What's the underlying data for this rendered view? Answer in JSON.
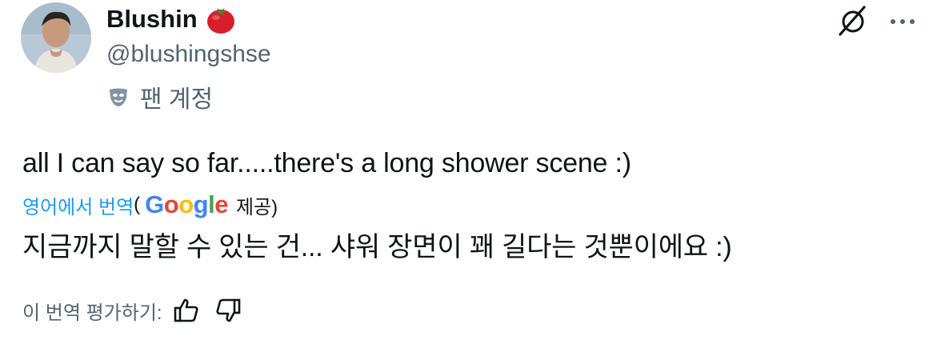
{
  "author": {
    "display_name": "Blushin",
    "handle": "@blushingshse",
    "badge_label": "팬 계정"
  },
  "icons": {
    "avatar": "profile-photo",
    "name_emoji": "tomato-icon",
    "badge": "theater-mask-icon",
    "grok": "grok-icon",
    "more": "more-icon",
    "thumbs_up": "thumbs-up-icon",
    "thumbs_down": "thumbs-down-icon"
  },
  "tweet": {
    "text": "all I can say so far.....there's a long shower scene :)",
    "translate_link": "영어에서 번역",
    "paren_open": "(",
    "google": [
      "G",
      "o",
      "o",
      "g",
      "l",
      "e"
    ],
    "provided": "제공)",
    "translated_text": "지금까지 말할 수 있는 건... 샤워 장면이 꽤 길다는 것뿐이에요 :)",
    "rate_label": "이 번역 평가하기:"
  },
  "colors": {
    "text": "#0f1419",
    "secondary": "#536471",
    "link": "#1d9bf0",
    "google_blue": "#4285F4",
    "google_red": "#EA4335",
    "google_yellow": "#FBBC05",
    "google_green": "#34A853"
  }
}
